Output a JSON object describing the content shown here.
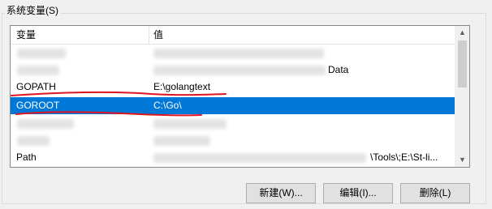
{
  "group": {
    "title": "系统变量(S)"
  },
  "list": {
    "columns": {
      "name": "变量",
      "value": "值"
    },
    "rows": [
      {
        "name": "",
        "value": ""
      },
      {
        "name": "",
        "value": "Data"
      },
      {
        "name": "GOPATH",
        "value": "E:\\golangtext"
      },
      {
        "name": "GOROOT",
        "value": "C:\\Go\\",
        "selected": true
      },
      {
        "name": "",
        "value": ""
      },
      {
        "name": "",
        "value": ""
      },
      {
        "name": "Path",
        "value": "\\Tools\\;E:\\St-li..."
      }
    ]
  },
  "scrollbar": {
    "up_icon": "▲",
    "down_icon": "▼"
  },
  "buttons": {
    "new": "新建(W)...",
    "edit": "编辑(I)...",
    "delete": "删除(L)"
  },
  "colors": {
    "selection": "#0078d7",
    "annotation": "#e0141e"
  }
}
